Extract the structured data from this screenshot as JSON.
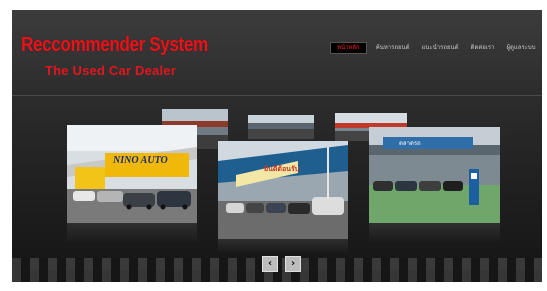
{
  "header": {
    "title": "Reccommender System",
    "subtitle": "The Used Car Dealer"
  },
  "nav": {
    "items": [
      {
        "label": "หน้าหลัก",
        "active": true
      },
      {
        "label": "ค้นหารถยนต์",
        "active": false
      },
      {
        "label": "แนะนำรถยนต์",
        "active": false
      },
      {
        "label": "ติดต่อเรา",
        "active": false
      },
      {
        "label": "ผู้ดูแลระบบ",
        "active": false
      }
    ]
  },
  "gallery": {
    "signs": {
      "left": "NINO AUTO",
      "center": "ยินดีต้อนรับ",
      "right": "ตลาดรถ"
    },
    "prev_icon": "chevron-left-icon",
    "next_icon": "chevron-right-icon"
  },
  "colors": {
    "brand_red": "#e3151c",
    "background": "#2b2b2b",
    "active_nav_bg": "#000000"
  }
}
